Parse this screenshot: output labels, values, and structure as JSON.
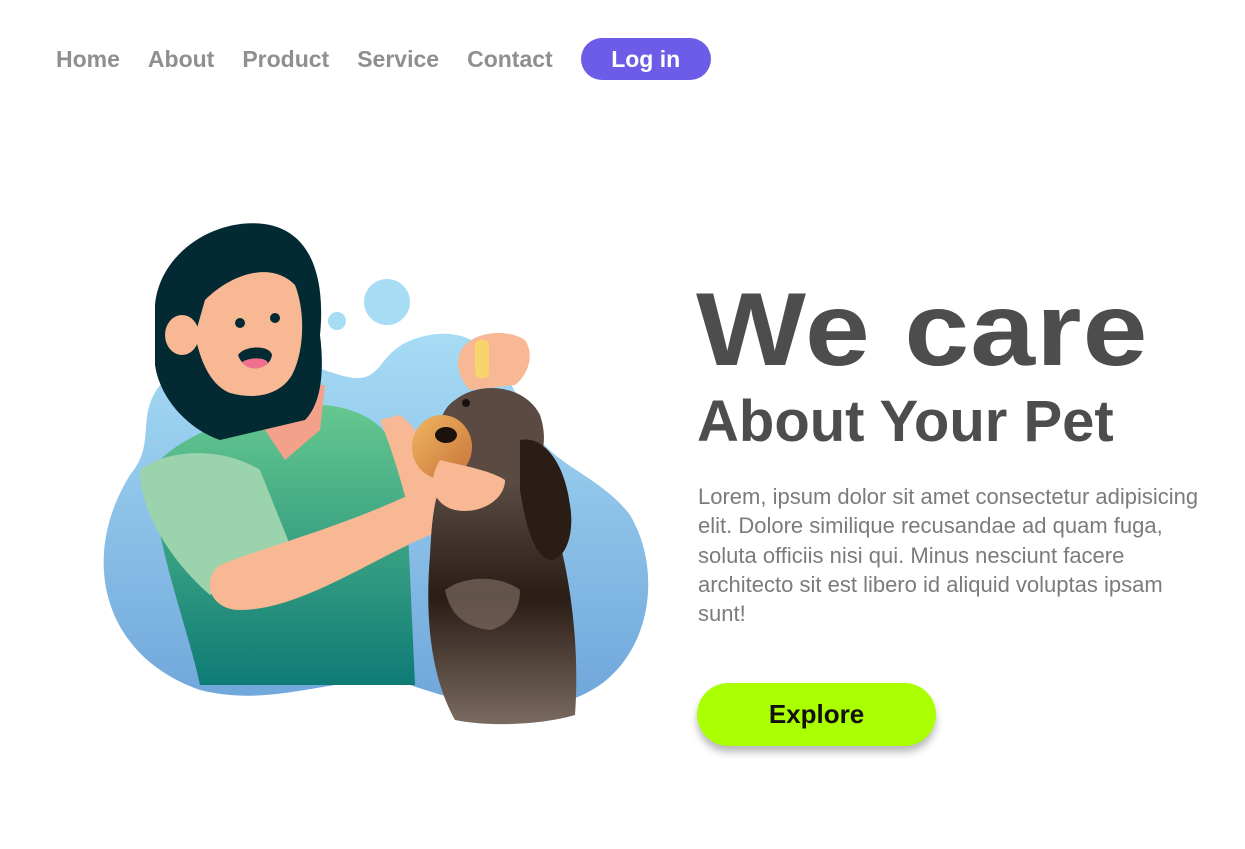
{
  "nav": {
    "links": [
      {
        "label": "Home"
      },
      {
        "label": "About"
      },
      {
        "label": "Product"
      },
      {
        "label": "Service"
      },
      {
        "label": "Contact"
      }
    ],
    "login_label": "Log in"
  },
  "hero": {
    "title": "We care",
    "subtitle": "About Your Pet",
    "description": "Lorem, ipsum dolor sit amet consectetur adipisicing elit. Dolore similique recusandae ad quam fuga, soluta officiis nisi qui. Minus nesciunt facere architecto sit est libero id aliquid voluptas ipsam sunt!",
    "cta_label": "Explore"
  },
  "colors": {
    "accent": "#6c5ce7",
    "cta": "#aaff00",
    "heading": "#4d4d4d",
    "nav_text": "#8f8f8f",
    "body_text": "#7b7b7b"
  },
  "illustration": {
    "icon": "woman-caring-for-dog-illustration"
  }
}
